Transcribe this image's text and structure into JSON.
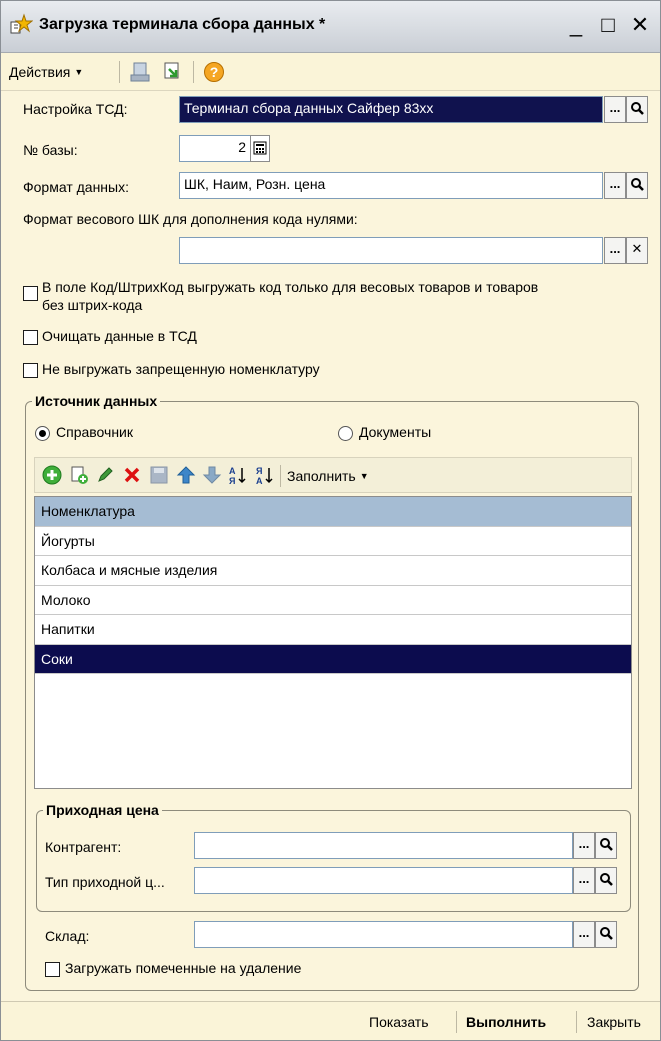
{
  "window": {
    "title": "Загрузка терминала сбора данных *",
    "minimize": "_",
    "maximize": "□",
    "close": "✕"
  },
  "toolbar": {
    "actions_label": "Действия",
    "icons": [
      "load-icon",
      "unload-icon",
      "help-icon"
    ]
  },
  "form": {
    "tsd_label": "Настройка ТСД:",
    "tsd_value": "Терминал сбора данных Сайфер 83хх",
    "base_label": "№ базы:",
    "base_value": "2",
    "format_label": "Формат данных:",
    "format_value": "ШК, Наим, Розн. цена",
    "weight_format_label": "Формат весового ШК для дополнения кода нулями:",
    "weight_format_value": "",
    "chk_weight_code_line1": "В поле Код/ШтрихКод выгружать код только для весовых товаров и товаров",
    "chk_weight_code_line2": "без штрих-кода",
    "chk_clear_tsd": "Очищать данные в ТСД",
    "chk_no_forbidden": "Не выгружать запрещенную номенклатуру",
    "select_btn": "...",
    "clear_btn": "✕"
  },
  "source": {
    "legend": "Источник данных",
    "radio_directory": "Справочник",
    "radio_documents": "Документы",
    "fill_label": "Заполнить",
    "table_header": "Номенклатура",
    "rows": [
      "Йогурты",
      "Колбаса и мясные изделия",
      "Молоко",
      "Напитки",
      "Соки"
    ]
  },
  "incoming": {
    "legend": "Приходная цена",
    "contractor_label": "Контрагент:",
    "contractor_value": "",
    "price_type_label": "Тип приходной ц...",
    "price_type_value": ""
  },
  "warehouse": {
    "label": "Склад:",
    "value": "",
    "chk_deleted": "Загружать помеченные на удаление"
  },
  "footer": {
    "show": "Показать",
    "run": "Выполнить",
    "close": "Закрыть"
  }
}
